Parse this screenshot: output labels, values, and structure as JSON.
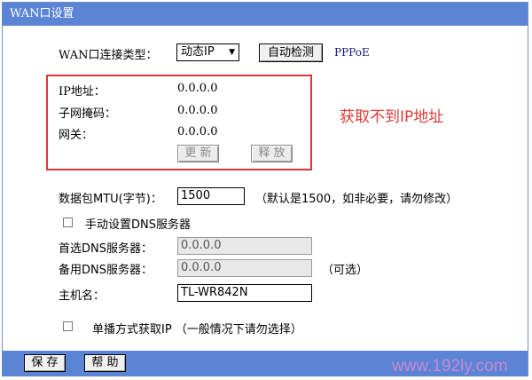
{
  "window": {
    "title": "WAN口设置"
  },
  "wan": {
    "type_label": "WAN口连接类型：",
    "type_value": "动态IP",
    "autodetect_label": "自动检测",
    "pppoe_link": "PPPoE"
  },
  "status": {
    "ip_label": "IP地址：",
    "ip_value": "0.0.0.0",
    "mask_label": "子网掩码：",
    "mask_value": "0.0.0.0",
    "gateway_label": "网关：",
    "gateway_value": "0.0.0.0",
    "renew_label": "更 新",
    "release_label": "释 放"
  },
  "annotation": {
    "text": "获取不到IP地址",
    "color": "#e03a3a"
  },
  "mtu": {
    "label": "数据包MTU(字节)：",
    "value": "1500",
    "hint": "（默认是1500，如非必要，请勿修改）"
  },
  "dns": {
    "manual_label": "手动设置DNS服务器",
    "primary_label": "首选DNS服务器：",
    "primary_value": "0.0.0.0",
    "secondary_label": "备用DNS服务器：",
    "secondary_value": "0.0.0.0",
    "optional_hint": "（可选）"
  },
  "host": {
    "label": "主机名：",
    "value": "TL-WR842N"
  },
  "unicast": {
    "label": "单播方式获取IP （一般情况下请勿选择）"
  },
  "footer": {
    "save_label": "保 存",
    "help_label": "帮 助"
  },
  "watermark": {
    "text": "www.192ly.com"
  },
  "colors": {
    "title_bar": "#5b84d5",
    "annotation_box": "#d83a3a"
  }
}
